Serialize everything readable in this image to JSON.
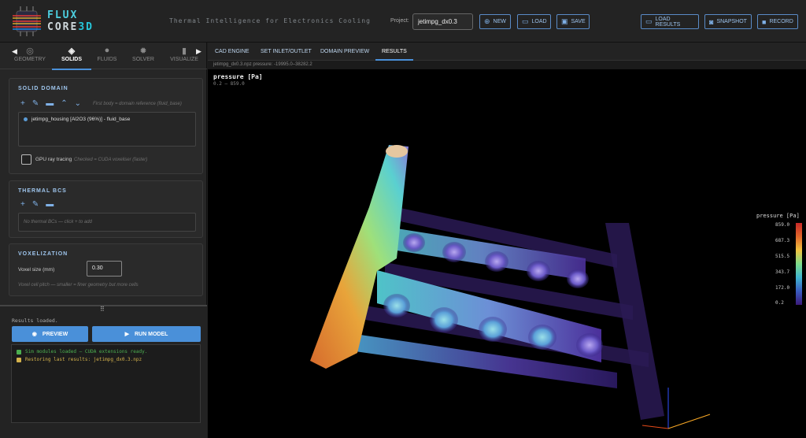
{
  "app": {
    "brand_line1": "FLUX",
    "brand_line2_prefix": "CORE",
    "brand_line2_suffix": "3D",
    "tagline": "Thermal Intelligence for Electronics Cooling",
    "project_label": "Project:",
    "project_value": "jetimpg_dx0.3"
  },
  "toolbar": {
    "new": "NEW",
    "load": "LOAD",
    "save": "SAVE",
    "load_results": "LOAD RESULTS",
    "snapshot": "SNAPSHOT",
    "record": "RECORD"
  },
  "left_tabs": [
    {
      "label": "GEOMETRY",
      "icon": "geometry-icon"
    },
    {
      "label": "SOLIDS",
      "icon": "layers-icon"
    },
    {
      "label": "FLUIDS",
      "icon": "droplet-icon"
    },
    {
      "label": "SOLVER",
      "icon": "gear-icon"
    },
    {
      "label": "VISUALIZE",
      "icon": "bar-chart-icon"
    }
  ],
  "solid_domain": {
    "title": "SOLID DOMAIN",
    "hint": "First body = domain reference (fluid_base)",
    "items": [
      "jetimpg_housing [Al2O3 (96%)] - fluid_base"
    ],
    "gpu_label": "GPU ray tracing",
    "gpu_hint": "Checked = CUDA voxeliser (faster)"
  },
  "thermal_bcs": {
    "title": "THERMAL BCS",
    "empty": "No thermal BCs — click + to add"
  },
  "voxelization": {
    "title": "VOXELIZATION",
    "label": "Voxel size (mm)",
    "value": "0.30",
    "hint": "Voxel cell pitch — smaller = finer geometry but more cells"
  },
  "run": {
    "status": "Results loaded.",
    "preview": "PREVIEW",
    "run_model": "RUN MODEL",
    "console": [
      {
        "text": "Sim modules loaded — CUDA extensions ready.",
        "color": "#4caf50"
      },
      {
        "text": "Restoring last results: jetimpg_dx0.3.npz",
        "color": "#d4b24c"
      }
    ]
  },
  "right_tabs": [
    "CAD ENGINE",
    "SET INLET/OUTLET",
    "DOMAIN PREVIEW",
    "RESULTS"
  ],
  "file_info": "jetimpg_dx0.3.npz  pressure: -19995.0–38282.2",
  "viewport": {
    "title": "pressure [Pa]",
    "range": "0.2 – 859.0",
    "colorbar_title": "pressure [Pa]",
    "colorbar_ticks": [
      "859.0",
      "687.3",
      "515.5",
      "343.7",
      "172.0",
      "0.2"
    ]
  },
  "colors": {
    "accent": "#4a90d9",
    "section_title": "#9fc6ee",
    "brand": "#4dd0e1"
  }
}
